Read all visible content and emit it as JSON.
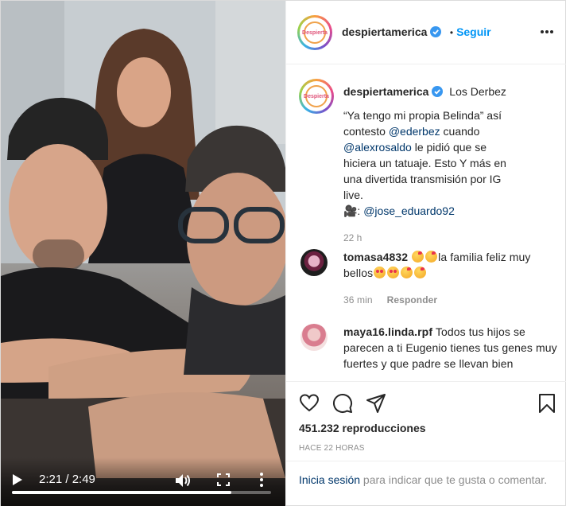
{
  "video": {
    "time_label": "2:21 / 2:49",
    "progress_fraction": 0.846,
    "icons": [
      "play-icon",
      "volume-icon",
      "fullscreen-icon",
      "more-vertical-icon"
    ]
  },
  "header": {
    "username": "despiertamerica",
    "separator": "•",
    "follow_label": "Seguir",
    "avatar_text": "Despierta"
  },
  "caption": {
    "username": "despiertamerica",
    "title": "Los Derbez",
    "text_1": "“Ya tengo mi propia Belinda” así contesto ",
    "mention_1": "@ederbez",
    "text_2": " cuando ",
    "mention_2": "@alexrosaldo",
    "text_3": " le pidió que se hiciera un tatuaje. Esto Y más en una divertida transmisión por IG live.",
    "camera_prefix": "🎥: ",
    "mention_3": "@jose_eduardo92",
    "time": "22 h"
  },
  "comments": [
    {
      "username": "tomasa4832",
      "text_1": "la familia feliz muy bellos",
      "time": "36 min",
      "reply_label": "Responder"
    },
    {
      "username": "maya16.linda.rpf",
      "text": "Todos tus hijos se parecen a ti Eugenio tienes tus genes muy fuertes y que padre se llevan bien"
    }
  ],
  "actions": {
    "views": "451.232 reproducciones",
    "age": "HACE 22 HORAS"
  },
  "login": {
    "link": "Inicia sesión",
    "text": " para indicar que te gusta o comentar."
  },
  "colors": {
    "link_blue": "#00376b",
    "follow_blue": "#0095f6",
    "verified_blue": "#3897f0",
    "muted": "#8e8e8e"
  }
}
